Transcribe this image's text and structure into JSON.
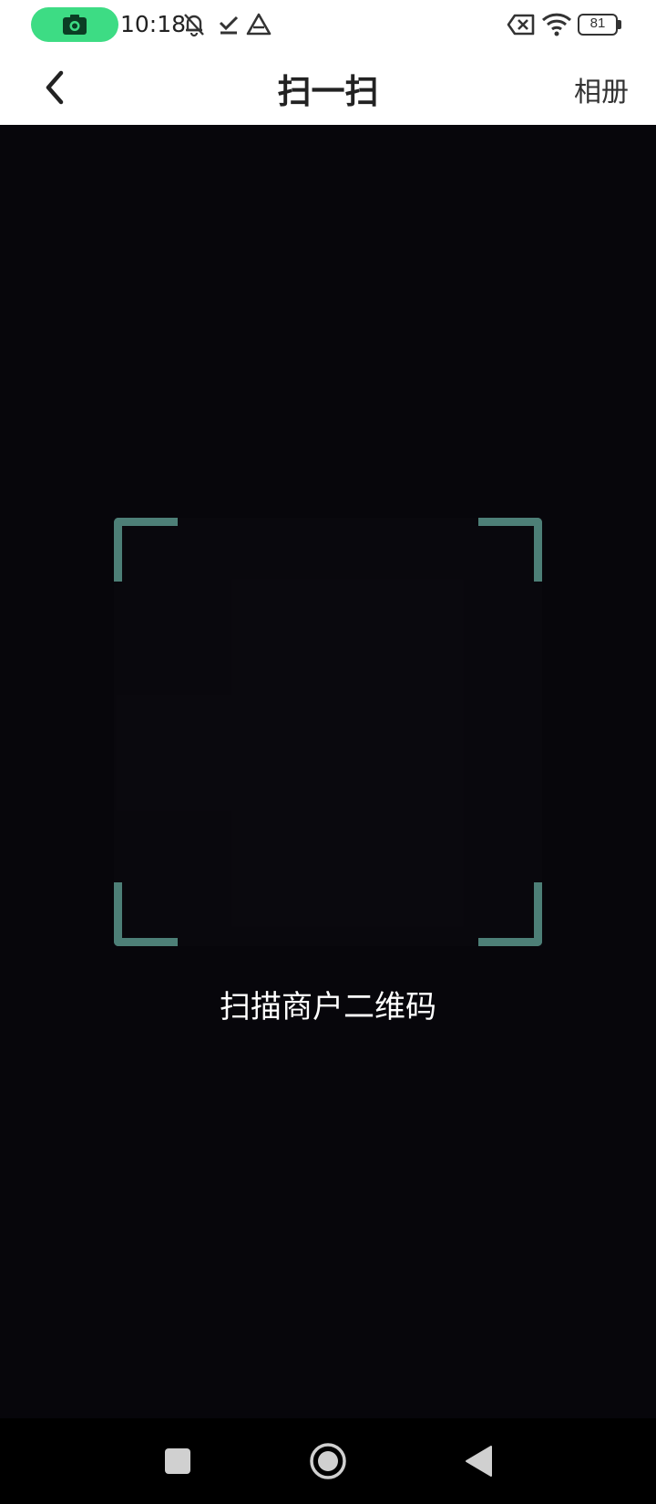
{
  "status_bar": {
    "time": "10:18",
    "battery": "81",
    "icons": [
      "camera-icon",
      "bell-off-icon",
      "download-done-icon",
      "drive-icon",
      "sim-off-icon",
      "wifi-icon",
      "battery-icon"
    ],
    "pill_color": "#3ddc84"
  },
  "header": {
    "title": "扫一扫",
    "album_label": "相册",
    "back_icon": "chevron-left-icon"
  },
  "scanner": {
    "hint": "扫描商户二维码",
    "frame_color": "#4d7f77",
    "background_color": "#07060b"
  },
  "nav_bar": {
    "icons": [
      "recents-square-icon",
      "home-circle-icon",
      "back-triangle-icon"
    ]
  }
}
